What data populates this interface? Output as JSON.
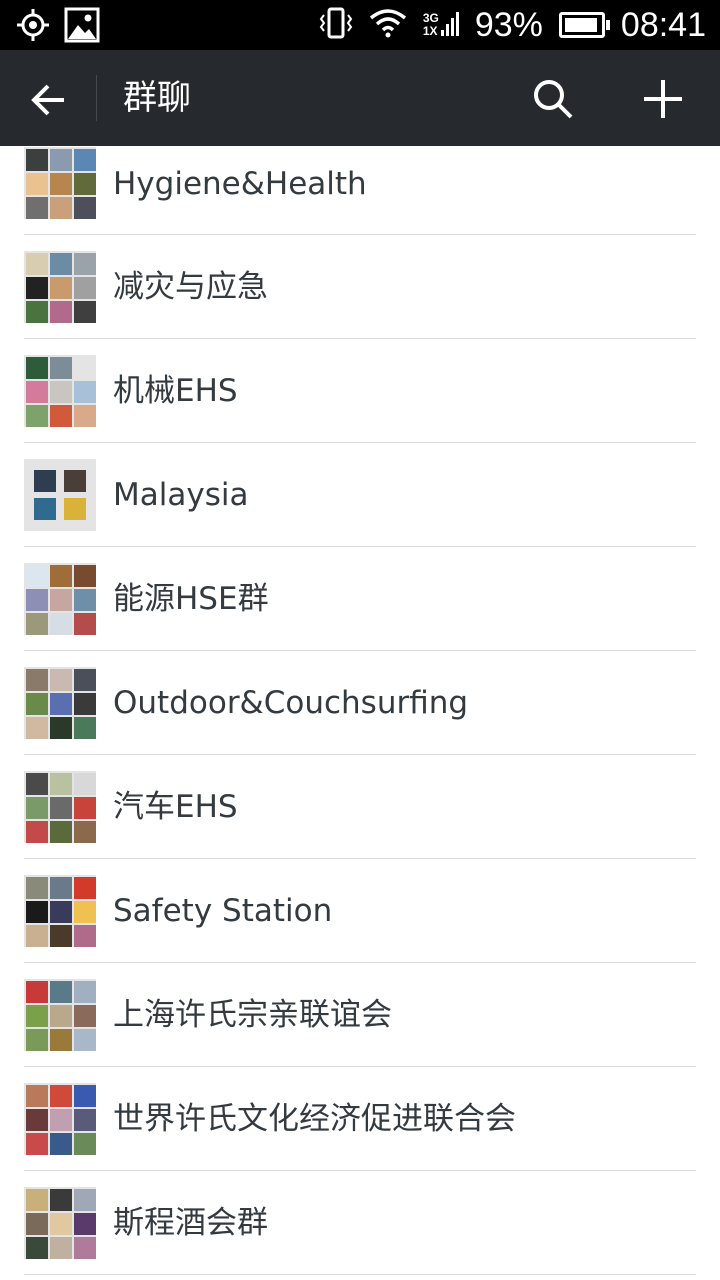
{
  "status_bar": {
    "battery_percent": "93%",
    "battery_level": 0.93,
    "time": "08:41",
    "network_3g": "3G",
    "network_1x": "1X",
    "icons": [
      "location-icon",
      "image-icon",
      "vibrate-icon",
      "wifi-icon",
      "signal-icon",
      "battery-icon"
    ]
  },
  "header": {
    "title": "群聊",
    "icons": [
      "back-arrow-icon",
      "search-icon",
      "add-icon"
    ],
    "background": "#262a2e"
  },
  "groups": [
    {
      "name": "Hygiene&Health",
      "avatar_colors": [
        "#3b3f3e",
        "#8a9bb0",
        "#5a87b4",
        "#e9c28f",
        "#b7864e",
        "#606a3a",
        "#6f6f6f",
        "#c9a07a",
        "#4d4f5a"
      ]
    },
    {
      "name": "减灾与应急",
      "avatar_colors": [
        "#d9cdb0",
        "#6c8ca6",
        "#9aa3aa",
        "#222222",
        "#c89a6e",
        "#a0a0a0",
        "#49733f",
        "#b26a8c",
        "#3f3f3f"
      ]
    },
    {
      "name": "机械EHS",
      "avatar_colors": [
        "#2e5c3a",
        "#7c8d98",
        "#e4e4e4",
        "#d47a9a",
        "#c9c5c0",
        "#a8c0d8",
        "#7ea36a",
        "#d15a3a",
        "#d9a98a"
      ]
    },
    {
      "name": "Malaysia",
      "avatar_colors": [
        "#2e3d4f",
        "#4a3f38",
        "#2f6a8f",
        "#d9b23a"
      ],
      "layout": "two"
    },
    {
      "name": "能源HSE群",
      "avatar_colors": [
        "#dce6ee",
        "#a06c38",
        "#7a4a2e",
        "#8d8fb5",
        "#c7a5a0",
        "#6f8ea8",
        "#9a9a7a",
        "#d6dde4",
        "#b44c4c"
      ]
    },
    {
      "name": "Outdoor&Couchsurfing",
      "avatar_colors": [
        "#8a7a6a",
        "#c9b9b0",
        "#4a4f5a",
        "#6a8a4a",
        "#5a6fb0",
        "#3a3a3a",
        "#d0b9a0",
        "#2a3a2a",
        "#4a7a5a"
      ]
    },
    {
      "name": "汽车EHS",
      "avatar_colors": [
        "#4a4a4a",
        "#b9c2a0",
        "#d8d8d8",
        "#7a9a6a",
        "#6a6a6a",
        "#c8443a",
        "#c24a4a",
        "#5a6a3a",
        "#8a6a4a"
      ]
    },
    {
      "name": "Safety Station",
      "avatar_colors": [
        "#8a8a7a",
        "#6a7a8a",
        "#d43a2a",
        "#1a1a1a",
        "#3a3a5a",
        "#f0c050",
        "#c9b090",
        "#4a3a2a",
        "#b06a8a"
      ]
    },
    {
      "name": "上海许氏宗亲联谊会",
      "avatar_colors": [
        "#c83a3a",
        "#5a7a8a",
        "#a0b0c0",
        "#7aa04a",
        "#b9a98a",
        "#8a6a5a",
        "#7a9a5a",
        "#9a7a3a",
        "#a8b8c8"
      ]
    },
    {
      "name": "世界许氏文化经济促进联合会",
      "avatar_colors": [
        "#b87a5a",
        "#d04a3a",
        "#3a5ab0",
        "#6a3a3a",
        "#c0a0b0",
        "#5a5a7a",
        "#c84a4a",
        "#3a5a8a",
        "#6a8a5a"
      ]
    },
    {
      "name": "斯程酒会群",
      "avatar_colors": [
        "#c9b07a",
        "#3a3a3a",
        "#a0a8b8",
        "#7a6a5a",
        "#e0c8a0",
        "#5a3a6a",
        "#3a4a3a",
        "#c0b0a0",
        "#b07a9a"
      ]
    }
  ]
}
